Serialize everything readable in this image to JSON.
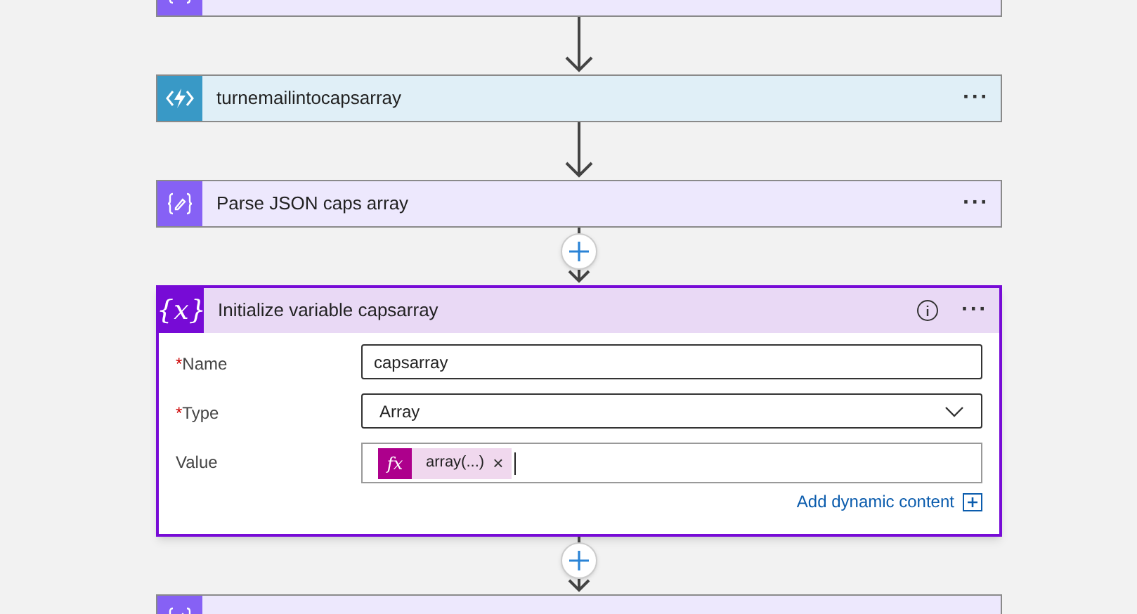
{
  "cards": [
    {
      "kind": "compose"
    },
    {
      "kind": "function",
      "add_button": false,
      "title": "turnemailintocapsarray",
      "menu": "···"
    },
    {
      "kind": "compose",
      "add_button": false,
      "title": "Parse JSON caps array",
      "menu": "···"
    },
    {
      "kind": "variable",
      "add_button": true,
      "icon_text": "{x}",
      "title": "Initialize variable capsarray",
      "info": true,
      "menu": "···",
      "expanded": true,
      "fields": [
        {
          "kind": "text",
          "label": "Name",
          "required_mark": "*",
          "value": "capsarray"
        },
        {
          "kind": "dropdown",
          "label": "Type",
          "required_mark": "*",
          "value": "Array"
        },
        {
          "kind": "token",
          "label": "Value",
          "token": {
            "icon_text": "fx",
            "text": "array(...)",
            "remove": "×"
          }
        }
      ],
      "link": "Add dynamic content"
    },
    {
      "kind": "compose",
      "add_button": true
    }
  ]
}
